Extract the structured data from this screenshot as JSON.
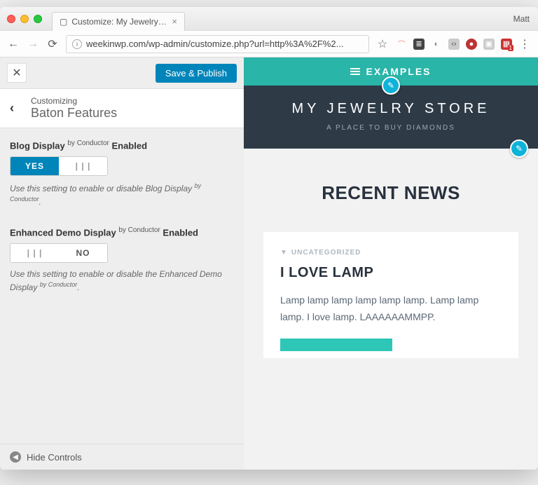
{
  "browser": {
    "tab_title": "Customize: My Jewelry store",
    "profile": "Matt",
    "url": "weekinwp.com/wp-admin/customize.php?url=http%3A%2F%2...",
    "star": "☆"
  },
  "customizer": {
    "save_label": "Save & Publish",
    "customizing_label": "Customizing",
    "section_title": "Baton Features",
    "hide_controls": "Hide Controls",
    "controls": [
      {
        "title_pre": "Blog Display ",
        "title_sup": "by Conductor",
        "title_post": " Enabled",
        "state": "yes",
        "yes": "YES",
        "no_grip": "| | |",
        "help_pre": "Use this setting to enable or disable Blog Display ",
        "help_sup": "by Conductor",
        "help_post": "."
      },
      {
        "title_pre": "Enhanced Demo Display ",
        "title_sup": "by Conductor",
        "title_post": " Enabled",
        "state": "no",
        "yes_grip": "| | |",
        "no": "NO",
        "help_pre": "Use this setting to enable or disable the Enhanced Demo Display ",
        "help_sup": "by Conductor",
        "help_post": "."
      }
    ]
  },
  "preview": {
    "topbar": "EXAMPLES",
    "site_title": "MY JEWELRY STORE",
    "tagline": "A PLACE TO BUY DIAMONDS",
    "recent_news": "RECENT NEWS",
    "post": {
      "category": "UNCATEGORIZED",
      "title": "I LOVE LAMP",
      "body": "Lamp lamp lamp lamp lamp lamp. Lamp lamp lamp. I love lamp. LAAAAAAMMPP."
    }
  }
}
